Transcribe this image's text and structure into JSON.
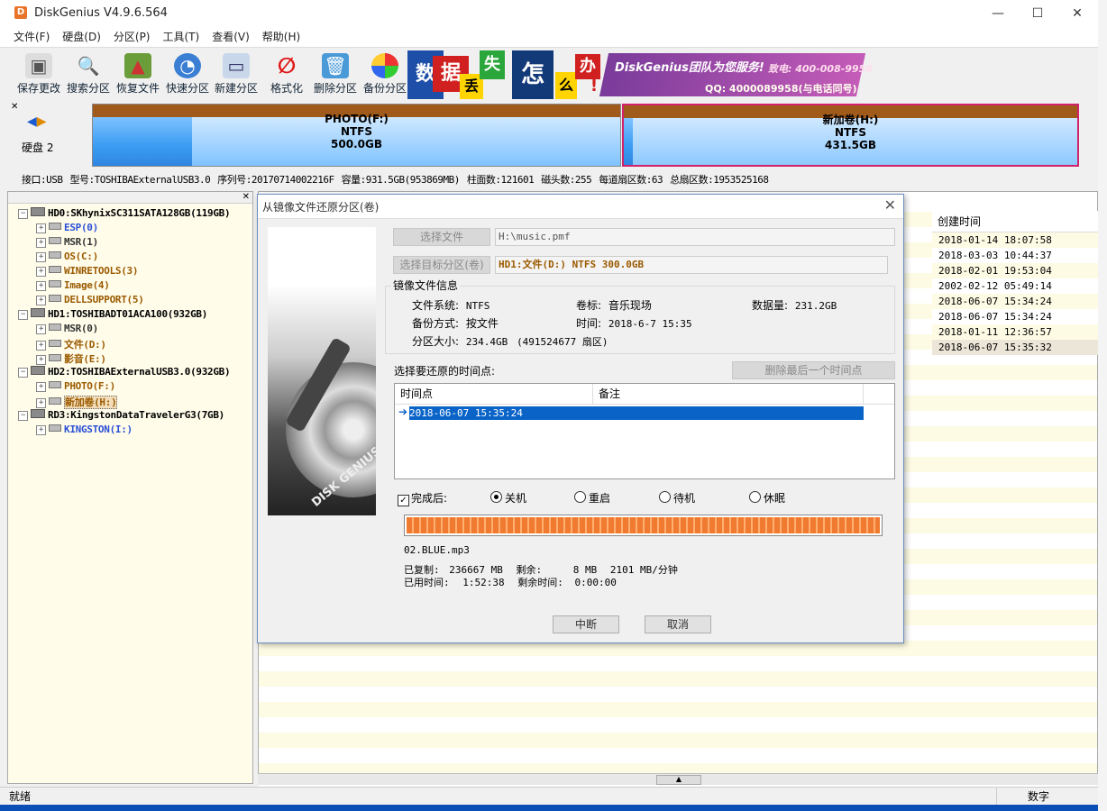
{
  "app": {
    "title": "DiskGenius V4.9.6.564",
    "icon_label": "D",
    "window_controls": [
      "—",
      "☐",
      "✕"
    ]
  },
  "menu": [
    "文件(F)",
    "硬盘(D)",
    "分区(P)",
    "工具(T)",
    "查看(V)",
    "帮助(H)"
  ],
  "toolbar": {
    "buttons": [
      {
        "label": "保存更改",
        "icon": "save-icon"
      },
      {
        "label": "搜索分区",
        "icon": "magnifier-icon"
      },
      {
        "label": "恢复文件",
        "icon": "recover-icon"
      },
      {
        "label": "快速分区",
        "icon": "quick-partition-icon"
      },
      {
        "label": "新建分区",
        "icon": "new-partition-icon"
      },
      {
        "label": "格式化",
        "icon": "format-icon"
      },
      {
        "label": "删除分区",
        "icon": "delete-icon"
      },
      {
        "label": "备份分区",
        "icon": "backup-icon"
      }
    ],
    "banner": {
      "chars": [
        "数",
        "据",
        "丢",
        "失",
        "怎",
        "么",
        "办",
        "!"
      ],
      "slogan": "DiskGenius团队为您服务!",
      "phone": "致电: 400-008-9958",
      "qq": "QQ: 4000089958(与电话同号)"
    }
  },
  "disk_map": {
    "disk_label": "硬盘 2",
    "partitions": [
      {
        "name": "PHOTO(F:)",
        "fs": "NTFS",
        "size": "500.0GB"
      },
      {
        "name": "新加卷(H:)",
        "fs": "NTFS",
        "size": "431.5GB"
      }
    ],
    "info": [
      "接口:USB",
      "型号:TOSHIBAExternalUSB3.0",
      "序列号:20170714002216F",
      "容量:931.5GB(953869MB)",
      "柱面数:121601",
      "磁头数:255",
      "每道扇区数:63",
      "总扇区数:1953525168"
    ]
  },
  "tree": {
    "nodes": [
      {
        "text": "HD0:SKhynixSC311SATA128GB(119GB)",
        "color": "#000000",
        "level": 0
      },
      {
        "text": "ESP(0)",
        "color": "#2a4fd6",
        "level": 1
      },
      {
        "text": "MSR(1)",
        "color": "#333333",
        "level": 1
      },
      {
        "text": "OS(C:)",
        "color": "#9a5a00",
        "level": 1
      },
      {
        "text": "WINRETOOLS(3)",
        "color": "#9a5a00",
        "level": 1
      },
      {
        "text": "Image(4)",
        "color": "#9a5a00",
        "level": 1
      },
      {
        "text": "DELLSUPPORT(5)",
        "color": "#9a5a00",
        "level": 1
      },
      {
        "text": "HD1:TOSHIBADT01ACA100(932GB)",
        "color": "#000000",
        "level": 0
      },
      {
        "text": "MSR(0)",
        "color": "#333333",
        "level": 1
      },
      {
        "text": "文件(D:)",
        "color": "#9a5a00",
        "level": 1
      },
      {
        "text": "影音(E:)",
        "color": "#9a5a00",
        "level": 1
      },
      {
        "text": "HD2:TOSHIBAExternalUSB3.0(932GB)",
        "color": "#000000",
        "level": 0
      },
      {
        "text": "PHOTO(F:)",
        "color": "#9a5a00",
        "level": 1
      },
      {
        "text": "新加卷(H:)",
        "color": "#9a5a00",
        "level": 1,
        "selected": true
      },
      {
        "text": "RD3:KingstonDataTravelerG3(7GB)",
        "color": "#000000",
        "level": 0
      },
      {
        "text": "KINGSTON(I:)",
        "color": "#2a4fd6",
        "level": 1
      }
    ]
  },
  "file_list": {
    "column_header": "创建时间",
    "dates": [
      "2018-01-14 18:07:58",
      "2018-03-03 10:44:37",
      "2018-02-01 19:53:04",
      "2002-02-12 05:49:14",
      "2018-06-07 15:34:24",
      "2018-06-07 15:34:24",
      "2018-01-11 12:36:57",
      "2018-06-07 15:35:32"
    ]
  },
  "dialog": {
    "title": "从镜像文件还原分区(卷)",
    "close": "✕",
    "select_file_btn": "选择文件",
    "file_path": "H:\\music.pmf",
    "select_target_btn": "选择目标分区(卷)",
    "target": "HD1:文件(D:) NTFS 300.0GB",
    "image_info_label": "镜像文件信息",
    "fs_label": "文件系统:",
    "fs_value": "NTFS",
    "vol_label": "卷标:",
    "vol_value": "音乐现场",
    "data_label": "数据量:",
    "data_value": "231.2GB",
    "method_label": "备份方式:",
    "method_value": "按文件",
    "time_label": "时间:",
    "time_value": "2018-6-7 15:35",
    "size_label": "分区大小:",
    "size_value": "234.4GB",
    "size_sectors": "(491524677 扇区)",
    "choose_point_label": "选择要还原的时间点:",
    "delete_last_btn": "删除最后一个时间点",
    "list_headers": [
      "时间点",
      "备注"
    ],
    "list_rows": [
      "2018-06-07 15:35:24"
    ],
    "after_label": "完成后:",
    "options": [
      "关机",
      "重启",
      "待机",
      "休眠"
    ],
    "selected_option": "关机",
    "progress_fraction": 1.0,
    "current_file": "02.BLUE.mp3",
    "copied_label": "已复制:",
    "copied_value": "236667 MB",
    "remain_label": "剩余:",
    "remain_value": "8 MB",
    "speed": "2101 MB/分钟",
    "elapsed_label": "已用时间:",
    "elapsed_value": "1:52:38",
    "remaining_time_label": "剩余时间:",
    "remaining_time_value": "0:00:00",
    "abort_btn": "中断",
    "cancel_btn": "取消"
  },
  "status": {
    "left": "就绪",
    "right": "数字"
  }
}
